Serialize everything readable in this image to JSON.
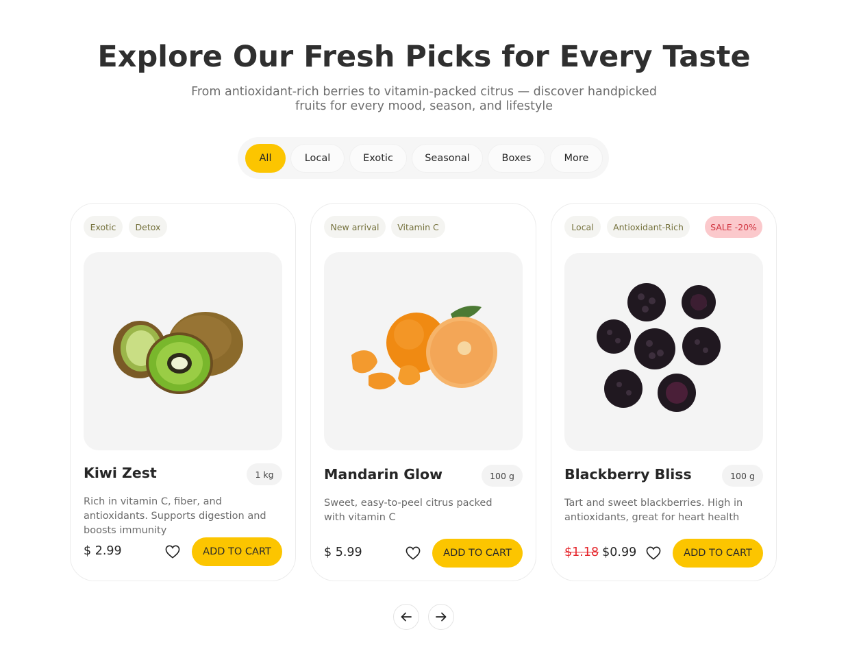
{
  "header": {
    "title": "Explore Our Fresh Picks for Every Taste",
    "subtitle": "From antioxidant-rich berries to vitamin-packed citrus — discover handpicked fruits for every mood, season, and lifestyle"
  },
  "filters": [
    {
      "label": "All",
      "active": true
    },
    {
      "label": "Local",
      "active": false
    },
    {
      "label": "Exotic",
      "active": false
    },
    {
      "label": "Seasonal",
      "active": false
    },
    {
      "label": "Boxes",
      "active": false
    },
    {
      "label": "More",
      "active": false
    }
  ],
  "products": [
    {
      "tags": [
        "Exotic",
        "Detox"
      ],
      "name": "Kiwi Zest",
      "weight": "1 kg",
      "description": "Rich in vitamin C, fiber, and antioxidants. Supports digestion and boosts immunity",
      "price": "$ 2.99",
      "cart_label": "ADD TO CART",
      "image": "kiwi-image"
    },
    {
      "tags": [
        "New arrival",
        "Vitamin C"
      ],
      "name": "Mandarin Glow",
      "weight": "100 g",
      "description": "Sweet, easy-to-peel citrus packed with vitamin C",
      "price": "$ 5.99",
      "cart_label": "ADD TO CART",
      "image": "mandarin-image"
    },
    {
      "tags": [
        "Local",
        "Antioxidant-Rich"
      ],
      "sale_badge": "SALE -20%",
      "name": "Blackberry Bliss",
      "weight": "100 g",
      "description": "Tart and sweet blackberries. High in antioxidants, great for heart health",
      "old_price": "$1.18",
      "price": "$0.99",
      "cart_label": "ADD TO CART",
      "image": "blackberry-image"
    }
  ],
  "pagination": {
    "prev_icon": "arrow-left-icon",
    "next_icon": "arrow-right-icon"
  },
  "colors": {
    "accent": "#fcc500",
    "sale_red": "#e5252b",
    "tag_text": "#74713c"
  }
}
